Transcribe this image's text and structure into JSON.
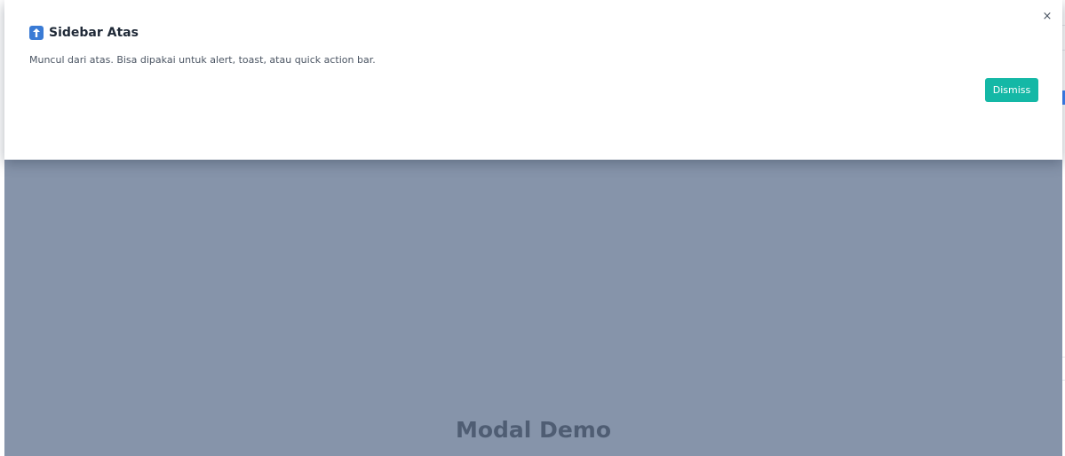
{
  "sheet": {
    "icon": "arrow-up-icon",
    "title": "Sidebar Atas",
    "description": "Muncul dari atas. Bisa dipakai untuk alert, toast, atau quick action bar.",
    "close_label": "×",
    "dismiss_label": "Dismiss"
  },
  "background": {
    "title": "Modal Demo"
  },
  "colors": {
    "overlay": "#8694aa",
    "dismiss_button": "#14b8a6",
    "icon_bg": "#3a7bd5",
    "title_text": "#1f2937",
    "demo_title_text": "#4f5d73"
  }
}
